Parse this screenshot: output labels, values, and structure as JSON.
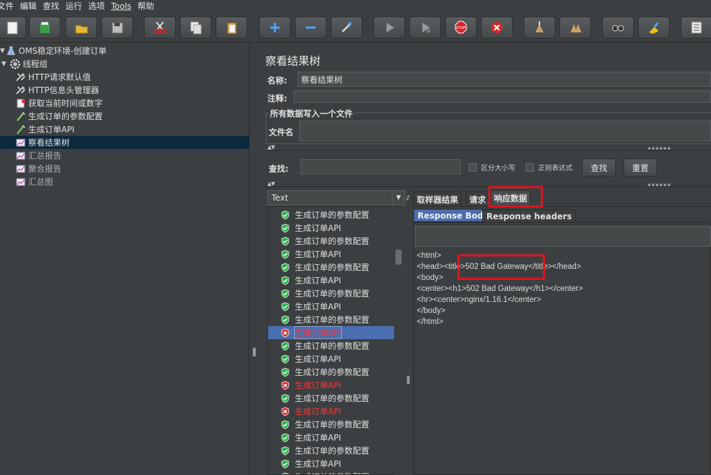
{
  "menu": [
    "文件",
    "编辑",
    "查找",
    "运行",
    "选项",
    "Tools",
    "帮助"
  ],
  "toolbar_icons": [
    "new-icon",
    "templates-icon",
    "open-icon",
    "save-icon",
    "cut-icon",
    "copy-icon",
    "paste-icon",
    "expand-icon",
    "collapse-icon",
    "toggle-icon",
    "start-icon",
    "start-no-pause-icon",
    "stop-icon",
    "shutdown-icon",
    "clear-icon",
    "clear-all-icon",
    "search-icon",
    "reset-search-icon",
    "function-helper-icon"
  ],
  "tree": {
    "root": "OMS稳定环境-创建订单",
    "thread_group": "线程组",
    "items": [
      {
        "label": "HTTP请求默认值",
        "icon": "wrench-icon"
      },
      {
        "label": "HTTP信息头管理器",
        "icon": "wrench-icon"
      },
      {
        "label": "获取当前时间或数字",
        "icon": "script-icon"
      },
      {
        "label": "生成订单的参数配置",
        "icon": "sampler-icon"
      },
      {
        "label": "生成订单API",
        "icon": "sampler-icon"
      },
      {
        "label": "察看结果树",
        "icon": "listener-icon",
        "selected": true
      },
      {
        "label": "汇总报告",
        "icon": "listener-icon",
        "dim": true
      },
      {
        "label": "聚合报告",
        "icon": "listener-icon",
        "dim": true
      },
      {
        "label": "汇总图",
        "icon": "listener-icon",
        "dim": true
      }
    ]
  },
  "panel": {
    "title": "察看结果树",
    "name_label": "名称:",
    "name_value": "察看结果树",
    "comment_label": "注释:",
    "file_group_title": "所有数据写入一个文件",
    "filename_label": "文件名",
    "search_label": "查找:",
    "case_sensitive": "区分大小写",
    "regex": "正则表达式",
    "search_button": "查找",
    "reset_button": "重置"
  },
  "renderer": "Text",
  "results": [
    {
      "label": "生成订单的参数配置",
      "status": "ok"
    },
    {
      "label": "生成订单API",
      "status": "ok"
    },
    {
      "label": "生成订单的参数配置",
      "status": "ok"
    },
    {
      "label": "生成订单API",
      "status": "ok"
    },
    {
      "label": "生成订单的参数配置",
      "status": "ok"
    },
    {
      "label": "生成订单API",
      "status": "ok"
    },
    {
      "label": "生成订单的参数配置",
      "status": "ok"
    },
    {
      "label": "生成订单API",
      "status": "ok"
    },
    {
      "label": "生成订单的参数配置",
      "status": "ok"
    },
    {
      "label": "生成订单API",
      "status": "error",
      "selected": true
    },
    {
      "label": "生成订单的参数配置",
      "status": "ok"
    },
    {
      "label": "生成订单API",
      "status": "ok"
    },
    {
      "label": "生成订单的参数配置",
      "status": "ok"
    },
    {
      "label": "生成订单API",
      "status": "error"
    },
    {
      "label": "生成订单的参数配置",
      "status": "ok"
    },
    {
      "label": "生成订单API",
      "status": "error"
    },
    {
      "label": "生成订单的参数配置",
      "status": "ok"
    },
    {
      "label": "生成订单API",
      "status": "ok"
    },
    {
      "label": "生成订单的参数配置",
      "status": "ok"
    },
    {
      "label": "生成订单API",
      "status": "ok"
    },
    {
      "label": "生成订单的参数配置",
      "status": "ok"
    }
  ],
  "tabs": [
    "取样器结果",
    "请求",
    "响应数据"
  ],
  "subtabs": [
    "Response Body",
    "Response headers"
  ],
  "response_lines": [
    "<html>",
    "<head><title>502 Bad Gateway</title></head>",
    "<body>",
    "<center><h1>502 Bad Gateway</h1></center>",
    "<hr><center>nginx/1.16.1</center>",
    "</body>",
    "</html>"
  ],
  "colors": {
    "accent": "#4b6eaf",
    "error": "#ff3333",
    "highlight_box": "#e0141e",
    "ok": "#2bb14a"
  }
}
